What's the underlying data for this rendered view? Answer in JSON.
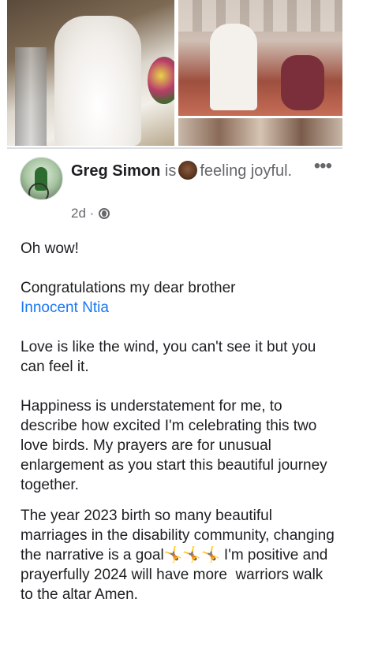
{
  "photos": {
    "items": [
      "wedding-photo-bride",
      "wedding-photo-ceremony",
      "wedding-photo-guests"
    ]
  },
  "post": {
    "author": "Greg Simon",
    "is_text": "is",
    "feeling_text": "feeling joyful.",
    "time": "2d ·",
    "privacy_icon": "globe-icon",
    "more_icon": "more-options-icon",
    "paragraphs": {
      "p1": "Oh wow!",
      "p2": "Congratulations my dear brother",
      "mention": "Innocent Ntia",
      "p3": "Love is like the wind, you can't see it but you can feel it.",
      "p4": "Happiness is understatement for me, to describe how excited I'm celebrating this two love birds. My prayers are for unusual enlargement as you start this beautiful journey together.",
      "p5": "The year 2023 birth so many beautiful marriages in the disability community, changing the narrative is a goal🤸🤸🤸 I'm positive and prayerfully 2024 will have more  warriors walk to the altar Amen."
    }
  },
  "colors": {
    "link": "#1877f2",
    "secondary_text": "#65676b",
    "primary_text": "#1c1e21"
  }
}
